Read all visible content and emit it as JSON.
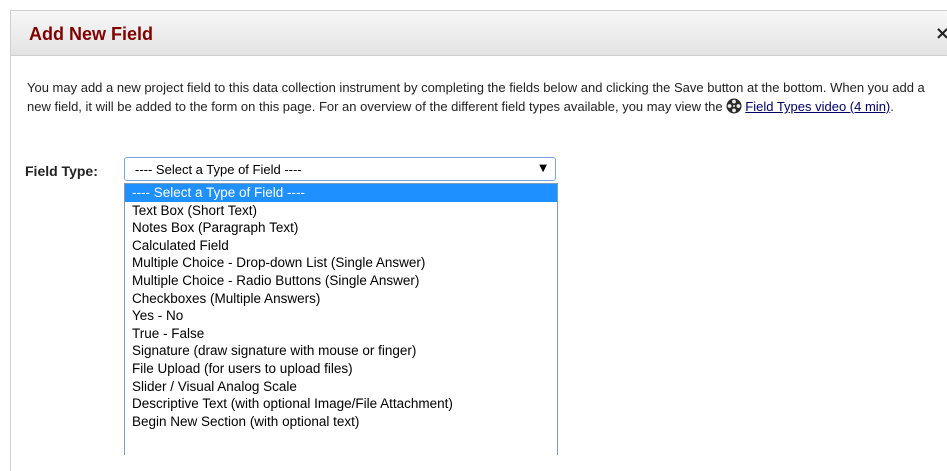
{
  "dialog": {
    "title": "Add New Field",
    "close_label": "×"
  },
  "intro": {
    "text": "You may add a new project field to this data collection instrument by completing the fields below and clicking the Save button at the bottom. When you add a new field, it will be added to the form on this page. For an overview of the different field types available, you may view the ",
    "film_icon": "film-reel-icon",
    "link_text": "Field Types video (4 min)",
    "after_link": "."
  },
  "field_type": {
    "label": "Field Type:",
    "selected_value": "---- Select a Type of Field ----",
    "options": [
      "---- Select a Type of Field ----",
      "Text Box (Short Text)",
      "Notes Box (Paragraph Text)",
      "Calculated Field",
      "Multiple Choice - Drop-down List (Single Answer)",
      "Multiple Choice - Radio Buttons (Single Answer)",
      "Checkboxes (Multiple Answers)",
      "Yes - No",
      "True - False",
      "Signature (draw signature with mouse or finger)",
      "File Upload (for users to upload files)",
      "Slider / Visual Analog Scale",
      "Descriptive Text (with optional Image/File Attachment)",
      "Begin New Section (with optional text)"
    ]
  },
  "colors": {
    "title": "#800000",
    "link": "#000066",
    "highlight": "#1e90ff"
  }
}
